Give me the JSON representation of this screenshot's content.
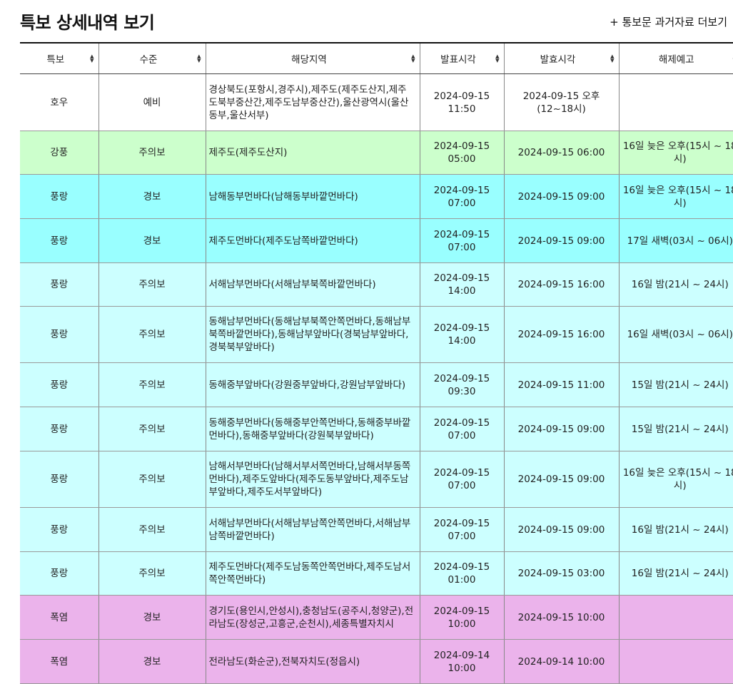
{
  "page": {
    "title": "특보 상세내역 보기",
    "archive_link": "+ 통보문 과거자료 더보기"
  },
  "columns": [
    "특보",
    "수준",
    "해당지역",
    "발표시각",
    "발효시각",
    "해제예고"
  ],
  "colors": {
    "호우": "#ffffff",
    "강풍_주의보": "#ccffcc",
    "풍랑_경보": "#99ffff",
    "풍랑_주의보": "#ccffff",
    "폭염": "#ebb3eb"
  },
  "rows": [
    {
      "type": "호우",
      "level": "예비",
      "area": "경상북도(포항시,경주시),제주도(제주도산지,제주도북부중산간,제주도남부중산간),울산광역시(울산동부,울산서부)",
      "issued": "2024-09-15 11:50",
      "effective": "2024-09-15 오후(12~18시)",
      "release": "",
      "bg": "#ffffff",
      "h": 80
    },
    {
      "type": "강풍",
      "level": "주의보",
      "area": "제주도(제주도산지)",
      "issued": "2024-09-15 05:00",
      "effective": "2024-09-15 06:00",
      "release": "16일 늦은 오후(15시 ~ 18시)",
      "bg": "#ccffcc",
      "h": 61
    },
    {
      "type": "풍랑",
      "level": "경보",
      "area": "남해동부먼바다(남해동부바깥먼바다)",
      "issued": "2024-09-15 07:00",
      "effective": "2024-09-15 09:00",
      "release": "16일 늦은 오후(15시 ~ 18시)",
      "bg": "#99ffff",
      "h": 62
    },
    {
      "type": "풍랑",
      "level": "경보",
      "area": "제주도먼바다(제주도남쪽바깥먼바다)",
      "issued": "2024-09-15 07:00",
      "effective": "2024-09-15 09:00",
      "release": "17일 새벽(03시 ~ 06시)",
      "bg": "#99ffff",
      "h": 62
    },
    {
      "type": "풍랑",
      "level": "주의보",
      "area": "서해남부먼바다(서해남부북쪽바깥먼바다)",
      "issued": "2024-09-15 14:00",
      "effective": "2024-09-15 16:00",
      "release": "16일 밤(21시 ~ 24시)",
      "bg": "#ccffff",
      "h": 61
    },
    {
      "type": "풍랑",
      "level": "주의보",
      "area": "동해남부먼바다(동해남부북쪽안쪽먼바다,동해남부북쪽바깥먼바다),동해남부앞바다(경북남부앞바다,경북북부앞바다)",
      "issued": "2024-09-15 14:00",
      "effective": "2024-09-15 16:00",
      "release": "16일 새벽(03시 ~ 06시)",
      "bg": "#ccffff",
      "h": 79
    },
    {
      "type": "풍랑",
      "level": "주의보",
      "area": "동해중부앞바다(강원중부앞바다,강원남부앞바다)",
      "issued": "2024-09-15 09:30",
      "effective": "2024-09-15 11:00",
      "release": "15일 밤(21시 ~ 24시)",
      "bg": "#ccffff",
      "h": 62
    },
    {
      "type": "풍랑",
      "level": "주의보",
      "area": "동해중부먼바다(동해중부안쪽먼바다,동해중부바깥먼바다),동해중부앞바다(강원북부앞바다)",
      "issued": "2024-09-15 07:00",
      "effective": "2024-09-15 09:00",
      "release": "15일 밤(21시 ~ 24시)",
      "bg": "#ccffff",
      "h": 62
    },
    {
      "type": "풍랑",
      "level": "주의보",
      "area": "남해서부먼바다(남해서부서쪽먼바다,남해서부동쪽먼바다),제주도앞바다(제주도동부앞바다,제주도남부앞바다,제주도서부앞바다)",
      "issued": "2024-09-15 07:00",
      "effective": "2024-09-15 09:00",
      "release": "16일 늦은 오후(15시 ~ 18시)",
      "bg": "#ccffff",
      "h": 79
    },
    {
      "type": "풍랑",
      "level": "주의보",
      "area": "서해남부먼바다(서해남부남쪽안쪽먼바다,서해남부남쪽바깥먼바다)",
      "issued": "2024-09-15 07:00",
      "effective": "2024-09-15 09:00",
      "release": "16일 밤(21시 ~ 24시)",
      "bg": "#ccffff",
      "h": 62
    },
    {
      "type": "풍랑",
      "level": "주의보",
      "area": "제주도먼바다(제주도남동쪽안쪽먼바다,제주도남서쪽안쪽먼바다)",
      "issued": "2024-09-15 01:00",
      "effective": "2024-09-15 03:00",
      "release": "16일 밤(21시 ~ 24시)",
      "bg": "#ccffff",
      "h": 61
    },
    {
      "type": "폭염",
      "level": "경보",
      "area": "경기도(용인시,안성시),충청남도(공주시,청양군),전라남도(장성군,고흥군,순천시),세종특별자치시",
      "issued": "2024-09-15 10:00",
      "effective": "2024-09-15 10:00",
      "release": "",
      "bg": "#ebb3eb",
      "h": 62
    },
    {
      "type": "폭염",
      "level": "경보",
      "area": "전라남도(화순군),전북자치도(정읍시)",
      "issued": "2024-09-14 10:00",
      "effective": "2024-09-14 10:00",
      "release": "",
      "bg": "#ebb3eb",
      "h": 62
    }
  ]
}
